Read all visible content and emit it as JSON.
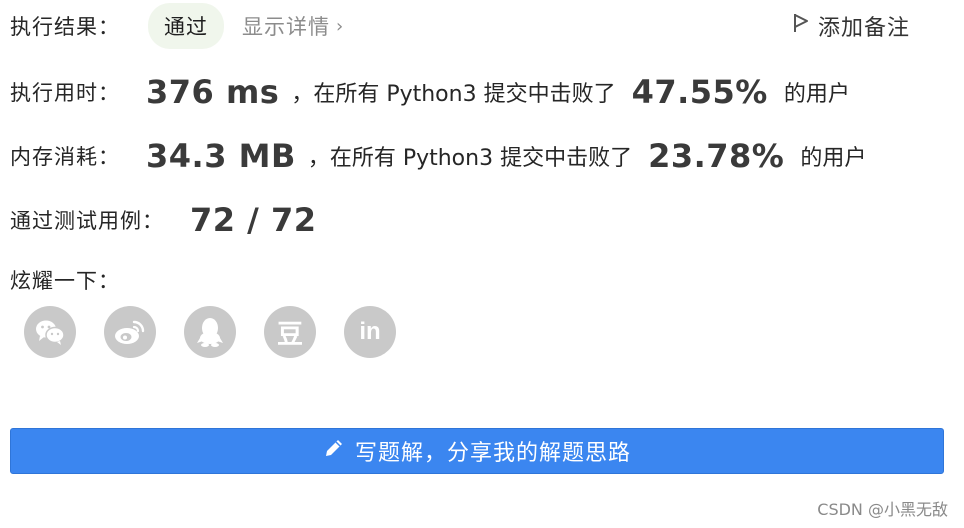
{
  "result": {
    "label": "执行结果：",
    "status": "通过",
    "details_link": "显示详情",
    "details_chevron": "›",
    "add_note": "添加备注"
  },
  "runtime": {
    "label": "执行用时：",
    "value": "376 ms",
    "text_before": "，在所有 Python3 提交中击败了",
    "percent": "47.55%",
    "text_after": "的用户"
  },
  "memory": {
    "label": "内存消耗：",
    "value": "34.3 MB",
    "text_before": "，在所有 Python3 提交中击败了",
    "percent": "23.78%",
    "text_after": "的用户"
  },
  "tests": {
    "label": "通过测试用例：",
    "value": "72 / 72"
  },
  "share": {
    "title": "炫耀一下：",
    "icons": [
      "wechat-icon",
      "weibo-icon",
      "qq-icon",
      "douban-icon",
      "linkedin-icon"
    ],
    "douban_glyph": "豆",
    "linkedin_glyph": "in"
  },
  "write_button": {
    "label": "写题解，分享我的解题思路"
  },
  "watermark": "CSDN @小黑无敌",
  "colors": {
    "accent_blue": "#3b86f0",
    "status_bg": "#f0f6ec",
    "icon_gray": "#c9c9c9"
  }
}
